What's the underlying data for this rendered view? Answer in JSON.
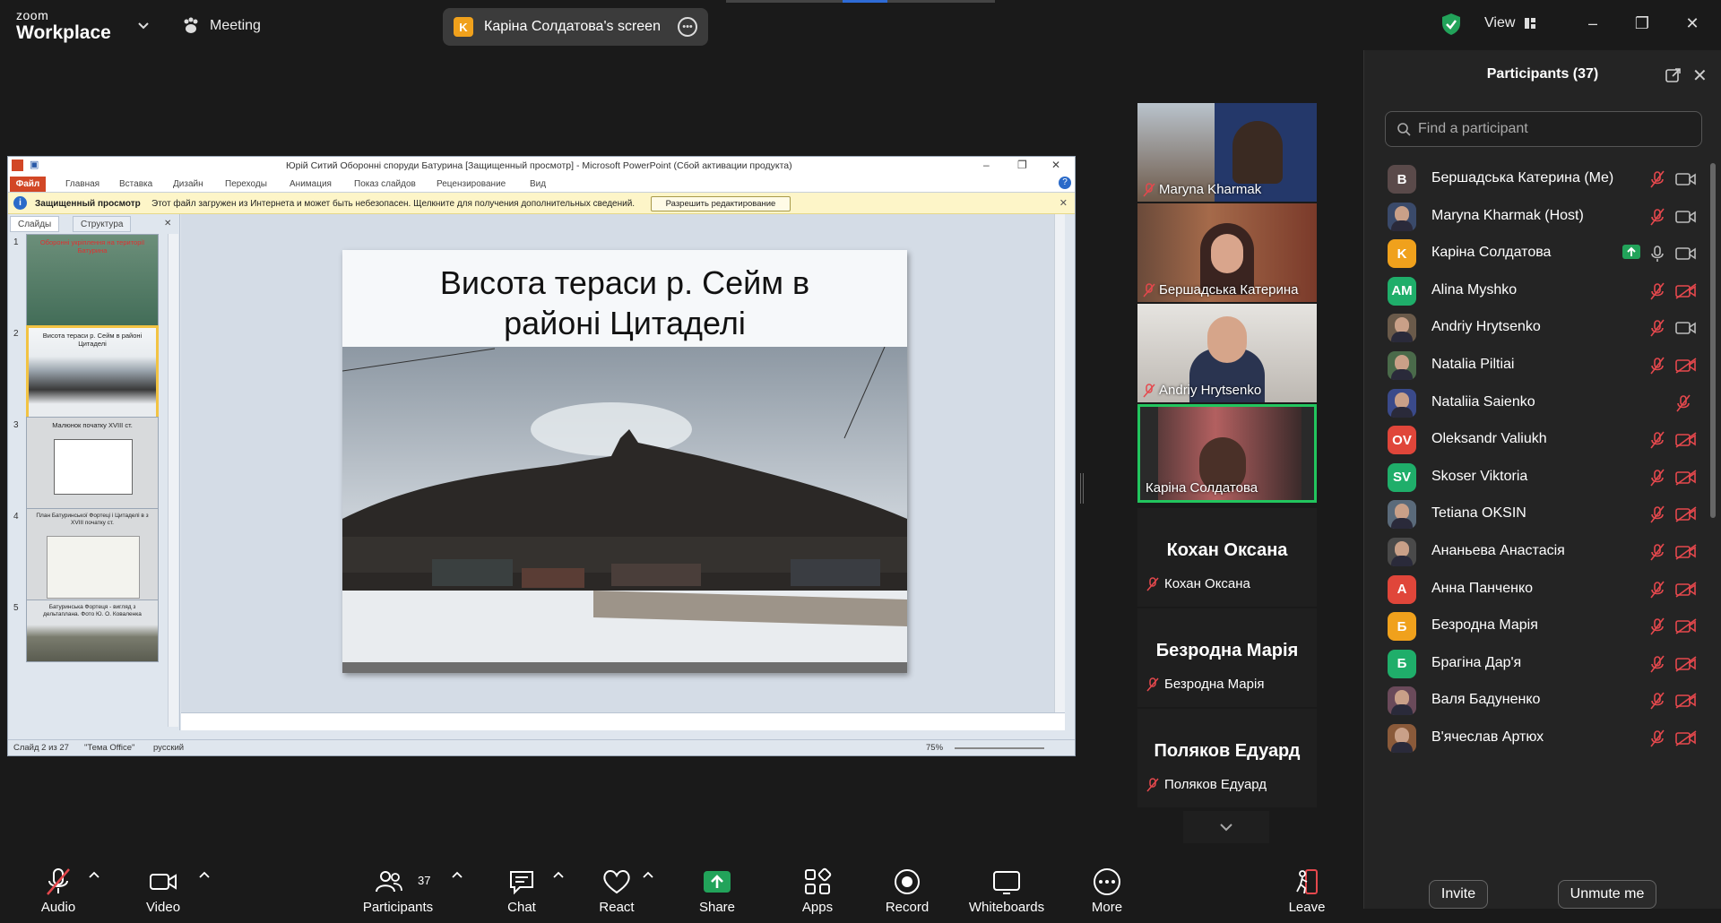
{
  "app": {
    "logo_line1": "zoom",
    "logo_line2": "Workplace",
    "meeting_label": "Meeting",
    "share_pill": {
      "avatar": "K",
      "label": "Каріна Солдатова's screen"
    },
    "view_label": "View",
    "colors": {
      "accent_green": "#22c55e",
      "mute_red": "#e5484d",
      "share_green": "#22a35a"
    }
  },
  "ppt": {
    "title": "Юрій Ситий Оборонні споруди Батурина [Защищенный просмотр] - Microsoft PowerPoint (Сбой активации продукта)",
    "file_tab": "Файл",
    "tabs": [
      "Главная",
      "Вставка",
      "Дизайн",
      "Переходы",
      "Анимация",
      "Показ слайдов",
      "Рецензирование",
      "Вид"
    ],
    "warning_bold": "Защищенный просмотр",
    "warning_text": "Этот файл загружен из Интернета и может быть небезопасен. Щелкните для получения дополнительных сведений.",
    "warning_button": "Разрешить редактирование",
    "left_tabs": [
      "Слайды",
      "Структура"
    ],
    "thumbnails": [
      {
        "num": "1",
        "caption": "Оборонні укріплення на території Батурина"
      },
      {
        "num": "2",
        "caption": "Висота тераси р. Сейм в районі Цитаделі"
      },
      {
        "num": "3",
        "caption": "Малюнок початку XVIII ст."
      },
      {
        "num": "4",
        "caption": "План Батуринської Фортеці і Цитаделі в з XVIII початку ст."
      },
      {
        "num": "5",
        "caption": "Батуринська Фортеця - вигляд з дельтаплана. Фото Ю. О. Коваленка"
      }
    ],
    "slide_title_line1": "Висота тераси р. Сейм в",
    "slide_title_line2": "районі Цитаделі",
    "status_slide": "Слайд 2 из 27",
    "status_theme": "\"Тема Office\"",
    "status_lang": "русский",
    "zoom_level": "75%"
  },
  "tiles": [
    {
      "name": "Maryna Kharmak"
    },
    {
      "name": "Бершадська Катерина"
    },
    {
      "name": "Andriy Hrytsenko"
    },
    {
      "name": "Каріна Солдатова"
    }
  ],
  "name_tiles": [
    {
      "big": "Кохан Оксана",
      "name": "Кохан Оксана"
    },
    {
      "big": "Безродна Марія",
      "name": "Безродна Марія"
    },
    {
      "big": "Поляков Едуард",
      "name": "Поляков Едуард"
    }
  ],
  "panel": {
    "title": "Participants (37)",
    "search_placeholder": "Find a participant",
    "participants": [
      {
        "name": "Бершадська Катерина (Me)",
        "avatar": "B",
        "color": "#5a4a4a",
        "photo": false,
        "mic": "off",
        "cam": "on"
      },
      {
        "name": "Maryna Kharmak (Host)",
        "avatar": "",
        "color": "#3a4a6a",
        "photo": true,
        "mic": "off",
        "cam": "on"
      },
      {
        "name": "Каріна Солдатова",
        "avatar": "K",
        "color": "#f0a11c",
        "photo": false,
        "mic": "on",
        "cam": "on",
        "sharing": true
      },
      {
        "name": "Alina Myshko",
        "avatar": "AM",
        "color": "#1fae6a",
        "photo": false,
        "mic": "off",
        "cam": "off"
      },
      {
        "name": "Andriy Hrytsenko",
        "avatar": "",
        "color": "#6a5a4a",
        "photo": true,
        "mic": "off",
        "cam": "on"
      },
      {
        "name": "Natalia Piltiai",
        "avatar": "",
        "color": "#4a6a4a",
        "photo": true,
        "mic": "off",
        "cam": "off"
      },
      {
        "name": "Nataliia Saienko",
        "avatar": "",
        "color": "#3a4a8a",
        "photo": true,
        "mic": "none",
        "cam": "off"
      },
      {
        "name": "Oleksandr Valiukh",
        "avatar": "OV",
        "color": "#e0463a",
        "photo": false,
        "mic": "off",
        "cam": "off"
      },
      {
        "name": "Skoser Viktoria",
        "avatar": "SV",
        "color": "#1fae6a",
        "photo": false,
        "mic": "off",
        "cam": "off"
      },
      {
        "name": "Tetiana OKSIN",
        "avatar": "",
        "color": "#5a6a7a",
        "photo": true,
        "mic": "off",
        "cam": "off"
      },
      {
        "name": "Ананьева Анастасія",
        "avatar": "",
        "color": "#4a4a4a",
        "photo": true,
        "mic": "off",
        "cam": "off"
      },
      {
        "name": "Анна Панченко",
        "avatar": "А",
        "color": "#e0463a",
        "photo": false,
        "mic": "off",
        "cam": "off"
      },
      {
        "name": "Безродна Марія",
        "avatar": "Б",
        "color": "#f0a11c",
        "photo": false,
        "mic": "off",
        "cam": "off"
      },
      {
        "name": "Брагіна Дар'я",
        "avatar": "Б",
        "color": "#1fae6a",
        "photo": false,
        "mic": "off",
        "cam": "off"
      },
      {
        "name": "Валя Бадуненко",
        "avatar": "",
        "color": "#6a4a5a",
        "photo": true,
        "mic": "off",
        "cam": "off"
      },
      {
        "name": "В'ячеслав Артюх",
        "avatar": "",
        "color": "#8a5a3a",
        "photo": true,
        "mic": "off",
        "cam": "off"
      }
    ],
    "invite_label": "Invite",
    "unmute_label": "Unmute me"
  },
  "toolbar": {
    "audio": "Audio",
    "video": "Video",
    "participants": "Participants",
    "participants_count": "37",
    "chat": "Chat",
    "react": "React",
    "share": "Share",
    "apps": "Apps",
    "record": "Record",
    "whiteboards": "Whiteboards",
    "more": "More",
    "leave": "Leave"
  }
}
